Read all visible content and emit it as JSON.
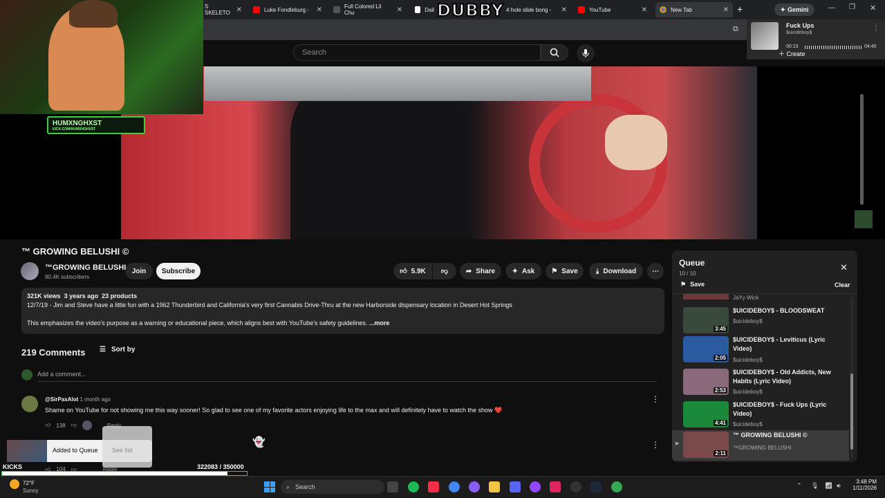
{
  "browser": {
    "tabs": [
      {
        "label": "S SKELETO",
        "icon": "youtube-icon"
      },
      {
        "label": "Luke Fondleburg - ",
        "icon": "youtube-icon"
      },
      {
        "label": "Full Colored Lil Chu",
        "icon": "generic-page-icon"
      },
      {
        "label": "Dail",
        "icon": "notion-icon"
      },
      {
        "label": "4 hole slide bong -",
        "icon": "generic-page-icon"
      },
      {
        "label": "YouTube",
        "icon": "youtube-icon"
      },
      {
        "label": "New Tab",
        "icon": "chrome-icon"
      }
    ],
    "new_tab": "+",
    "gemini_label": "Gemini"
  },
  "overlay": {
    "dubby": "DUBBY",
    "webcam_tag": "HUMXNGHXST",
    "webcam_sub": "KICK.COM/HUMXNGHXST"
  },
  "now_playing": {
    "title": "Fuck Ups",
    "artist": "$uicideboy$",
    "elapsed": "00:15",
    "total": "04:40",
    "create": "Create"
  },
  "masthead": {
    "search_placeholder": "Search"
  },
  "video": {
    "title": "™ GROWING BELUSHI ©",
    "channel": "™GROWING BELUSHI",
    "subscribers": "90.4K subscribers",
    "join": "Join",
    "subscribe": "Subscribe",
    "likes": "5.9K",
    "share": "Share",
    "ask": "Ask",
    "save": "Save",
    "download": "Download"
  },
  "description": {
    "views": "321K views",
    "age": "3 years ago",
    "products": "23 products",
    "line1": "12/7/19 - Jim and Steve have a little fun with a 1962 Thunderbird and California's very first Cannabis Drive-Thru at the new Harborside dispensary location in Desert Hot Springs",
    "line2": "This emphasizes the video's purpose as a warning or educational piece, which aligns best with YouTube's safety guidelines.",
    "more": "...more"
  },
  "comments": {
    "count": "219 Comments",
    "sort": "Sort by",
    "add_placeholder": "Add a comment...",
    "items": [
      {
        "author": "@SirPaxAlot",
        "age": "1 month ago",
        "text": "Shame on YouTube for not showing me this way sooner! So glad to see one of my favorite actors enjoying life to the max and will definitely have to watch the show ❤️",
        "likes": "138",
        "reply": "Reply"
      },
      {
        "likes": "104",
        "reply": "Reply"
      }
    ]
  },
  "toast": {
    "message": "Added to Queue",
    "action": "See list"
  },
  "kicks": {
    "label": "KICKS",
    "progress": "322083",
    "goal": "/ 350000",
    "progress_fraction": 0.92
  },
  "queue": {
    "title": "Queue",
    "position": "10 / 10",
    "save": "Save",
    "clear": "Clear",
    "partial_channel": "JaYy Wick",
    "items": [
      {
        "title": "$UICIDEBOY$ - BLOODSWEAT",
        "channel": "$uicideboy$",
        "duration": "3:45",
        "color": "#3a4a3a"
      },
      {
        "title": "$UICIDEBOY$ - Leviticus (Lyric Video)",
        "channel": "$uicideboy$",
        "duration": "2:05",
        "color": "#2c5aa0"
      },
      {
        "title": "$UICIDEBOY$ - Old Addicts, New Habits (Lyric Video)",
        "channel": "$uicideboy$",
        "duration": "2:53",
        "color": "#8a6a7a"
      },
      {
        "title": "$UICIDEBOY$ - Fuck Ups (Lyric Video)",
        "channel": "$uicideboy$",
        "duration": "4:41",
        "color": "#1a8a3a"
      },
      {
        "title": "™ GROWING BELUSHI ©",
        "channel": "™GROWING BELUSHI",
        "duration": "2:11",
        "color": "#7a4a4a"
      }
    ]
  },
  "taskbar": {
    "weather_temp": "72°F",
    "weather_desc": "Sunny",
    "search": "Search",
    "time": "3:48 PM",
    "date": "1/11/2026"
  }
}
